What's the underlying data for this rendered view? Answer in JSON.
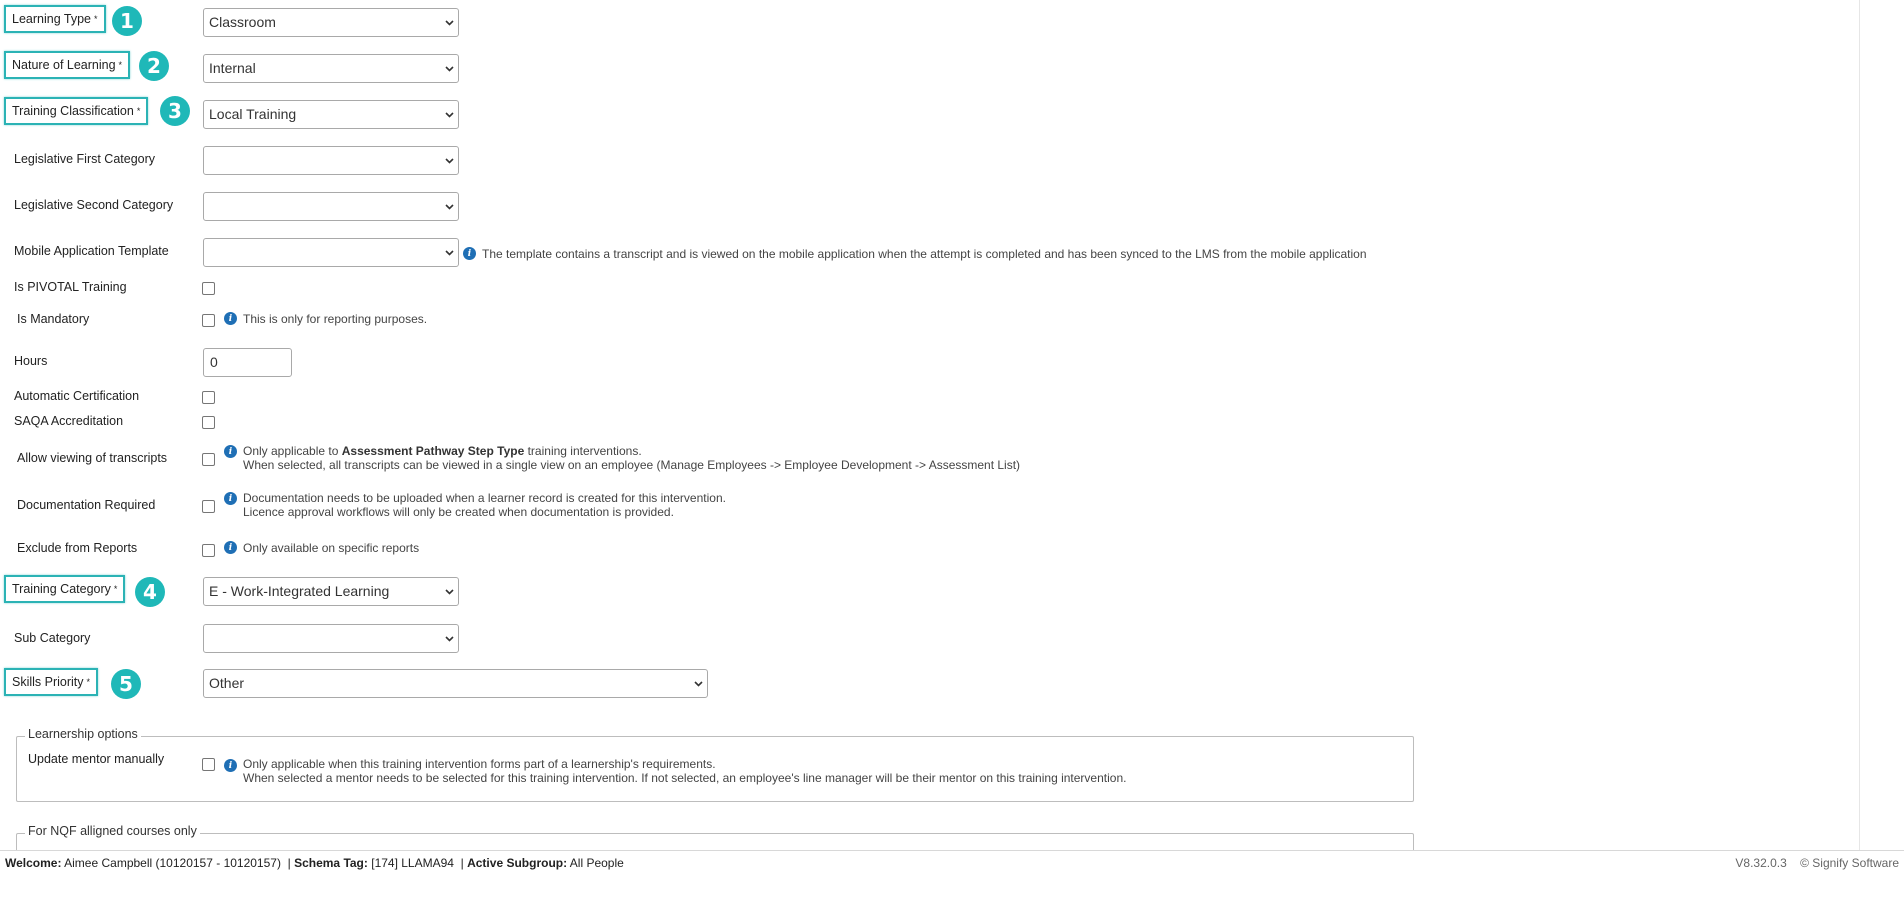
{
  "fields": {
    "learning_type": {
      "label": "Learning Type",
      "required_mark": "*",
      "badge": "1",
      "value": "Classroom"
    },
    "nature_of_learning": {
      "label": "Nature of Learning",
      "required_mark": "*",
      "badge": "2",
      "value": "Internal"
    },
    "training_classification": {
      "label": "Training Classification",
      "required_mark": "*",
      "badge": "3",
      "value": "Local Training"
    },
    "legislative_first_category": {
      "label": "Legislative First Category",
      "value": ""
    },
    "legislative_second_category": {
      "label": "Legislative Second Category",
      "value": ""
    },
    "mobile_application_template": {
      "label": "Mobile Application Template",
      "value": "",
      "info": "The template contains a transcript and is viewed on the mobile application when the attempt is completed and has been synced to the LMS from the mobile application"
    },
    "is_pivotal_training": {
      "label": "Is PIVOTAL Training"
    },
    "is_mandatory": {
      "label": "Is Mandatory",
      "info": "This is only for reporting purposes."
    },
    "hours": {
      "label": "Hours",
      "value": "0"
    },
    "automatic_certification": {
      "label": "Automatic Certification"
    },
    "saqa_accreditation": {
      "label": "SAQA Accreditation"
    },
    "allow_viewing_of_transcripts": {
      "label": "Allow viewing of transcripts",
      "info_prefix": "Only applicable to",
      "info_bold": "Assessment Pathway Step Type",
      "info_suffix": "training interventions.",
      "info_line2": "When selected, all transcripts can be viewed in a single view on an employee (Manage Employees -> Employee Development -> Assessment List)"
    },
    "documentation_required": {
      "label": "Documentation Required",
      "info_line1": "Documentation needs to be uploaded when a learner record is created for this intervention.",
      "info_line2": "Licence approval workflows will only be created when documentation is provided."
    },
    "exclude_from_reports": {
      "label": "Exclude from Reports",
      "info": "Only available on specific reports"
    },
    "training_category": {
      "label": "Training Category",
      "required_mark": "*",
      "badge": "4",
      "value": "E - Work-Integrated Learning"
    },
    "sub_category": {
      "label": "Sub Category",
      "value": ""
    },
    "skills_priority": {
      "label": "Skills Priority",
      "required_mark": "*",
      "badge": "5",
      "value": "Other"
    }
  },
  "learnership": {
    "legend": "Learnership options",
    "update_mentor_label": "Update mentor manually",
    "info_line1": "Only applicable when this training intervention forms part of a learnership's requirements.",
    "info_line2": "When selected a mentor needs to be selected for this training intervention. If not selected, an employee's line manager will be their mentor on this training intervention."
  },
  "nqf": {
    "legend": "For NQF alligned courses only"
  },
  "footer": {
    "welcome_label": "Welcome:",
    "welcome_value": "Aimee Campbell (10120157 - 10120157)",
    "schema_label": "Schema Tag:",
    "schema_value": "[174] LLAMA94",
    "subgroup_label": "Active Subgroup:",
    "subgroup_value": "All People",
    "version": "V8.32.0.3",
    "copyright": "© Signify Software"
  },
  "colors": {
    "highlight": "#2bb3b5",
    "badge": "#1fb8b8",
    "info": "#1f6fb5"
  },
  "icons": {
    "info": "info-icon",
    "dropdown": "chevron-down-icon"
  }
}
